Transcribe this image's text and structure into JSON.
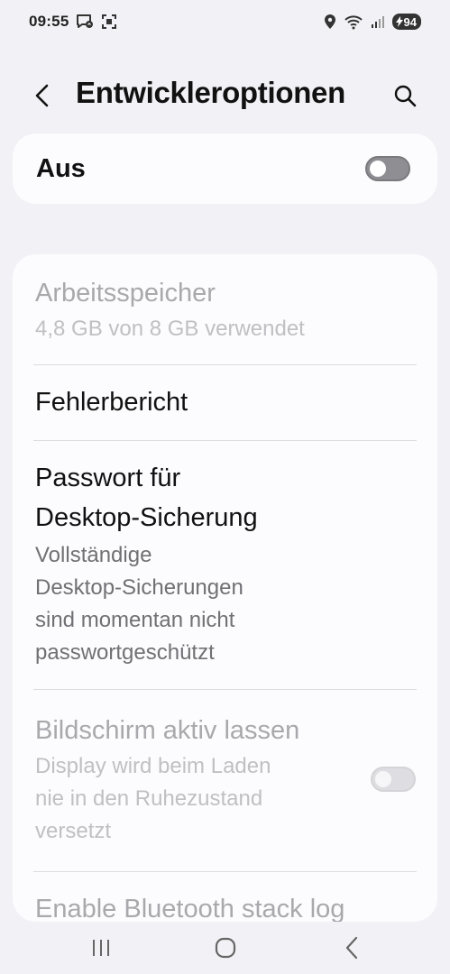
{
  "status_bar": {
    "time": "09:55",
    "battery": "94",
    "left_icons": [
      "messenger-notification-icon",
      "screenshot-notification-icon"
    ],
    "right_icons": [
      "location-icon",
      "wifi-icon",
      "signal-icon",
      "battery-charging-icon"
    ]
  },
  "header": {
    "title": "Entwickleroptionen",
    "back_icon": "back-chevron-icon",
    "search_icon": "search-icon"
  },
  "master_switch": {
    "label": "Aus",
    "enabled": false
  },
  "settings": [
    {
      "title": "Arbeitsspeicher",
      "subtitle": "4,8 GB von 8 GB verwendet",
      "disabled": true
    },
    {
      "title": "Fehlerbericht",
      "disabled": false
    },
    {
      "title_line1": "Passwort für",
      "title_line2": "Desktop-Sicherung",
      "subtitle_lines": [
        "Vollständige",
        "Desktop-Sicherungen",
        "sind momentan nicht",
        "passwortgeschützt"
      ],
      "disabled": false
    },
    {
      "title": "Bildschirm aktiv lassen",
      "subtitle_lines": [
        "Display wird beim Laden",
        "nie in den Ruhezustand",
        "versetzt"
      ],
      "disabled": true,
      "toggle_on": false
    },
    {
      "title": "Enable Bluetooth stack log",
      "disabled": true
    }
  ],
  "nav_bar": {
    "buttons": [
      "recent-apps-icon",
      "home-icon",
      "back-icon"
    ]
  },
  "colors": {
    "background": "#f2f2f6",
    "card": "#fcfcfe",
    "text_primary": "#111111",
    "text_secondary": "#707075",
    "text_disabled": "#a9a9ad",
    "toggle_off": "#8e8e93"
  }
}
